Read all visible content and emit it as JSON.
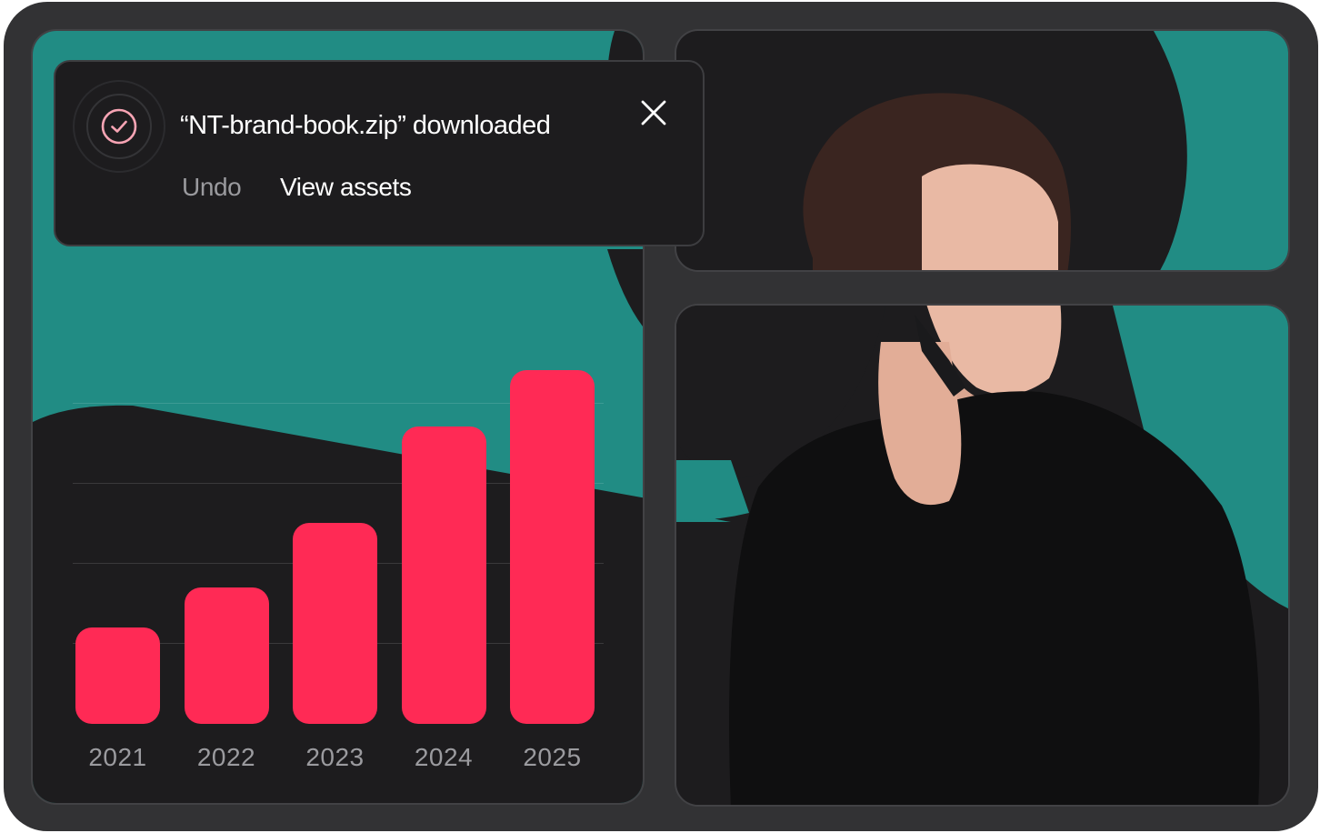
{
  "notification": {
    "title": "“NT-brand-book.zip” downloaded",
    "undo_label": "Undo",
    "view_label": "View assets",
    "icon": "check-circle-icon",
    "close_icon": "close-icon"
  },
  "chart_data": {
    "type": "bar",
    "categories": [
      "2021",
      "2022",
      "2023",
      "2024",
      "2025"
    ],
    "values": [
      12,
      17,
      25,
      37,
      44
    ],
    "ylim": [
      0,
      44
    ],
    "grid": true,
    "color": "#ff2a55"
  },
  "photo": {
    "icon": "person-on-phone-icon"
  },
  "colors": {
    "frame": "#323234",
    "panel_dark": "#1d1c1e",
    "teal": "#218c84",
    "bar": "#ff2a55",
    "muted_text": "#9b9b9f"
  }
}
